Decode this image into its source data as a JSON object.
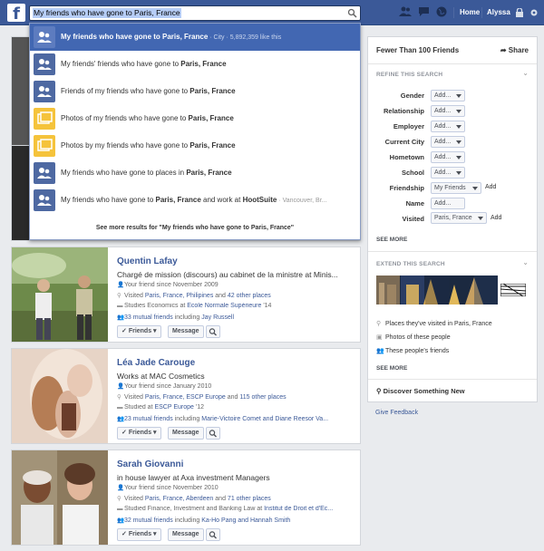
{
  "topbar": {
    "logo": "f",
    "search_value": "My friends who have gone to Paris, France",
    "home": "Home",
    "user": "Alyssa"
  },
  "typeahead": {
    "items": [
      {
        "pre": "My friends who have gone to ",
        "bold": "Paris, France",
        "post": "",
        "meta": " · City · 5,892,359 like this",
        "icon": "person-icon"
      },
      {
        "pre": "My friends' friends who have gone to ",
        "bold": "Paris, France",
        "post": "",
        "meta": "",
        "icon": "person-icon"
      },
      {
        "pre": "Friends of my friends who have gone to ",
        "bold": "Paris, France",
        "post": "",
        "meta": "",
        "icon": "person-icon"
      },
      {
        "pre": "Photos of my friends who have gone to ",
        "bold": "Paris, France",
        "post": "",
        "meta": "",
        "icon": "photo-icon"
      },
      {
        "pre": "Photos by my friends who have gone to ",
        "bold": "Paris, France",
        "post": "",
        "meta": "",
        "icon": "photo-icon"
      },
      {
        "pre": "My friends who have gone to places in ",
        "bold": "Paris, France",
        "post": "",
        "meta": "",
        "icon": "person-icon"
      },
      {
        "pre": "My friends who have gone to ",
        "bold": "Paris, France",
        "post": " and work at ",
        "bold2": "HootSuite",
        "meta": " · Vancouver, Br...",
        "icon": "person-icon"
      }
    ],
    "see_more": "See more results for \"My friends who have gone to Paris, France\""
  },
  "results": [
    {
      "name": "Quentin Lafay",
      "job": "Chargé de mission (discours) au cabinet de la ministre at Minis...",
      "since": "Your friend since November 2009",
      "visited_pre": "Visited ",
      "visited_links": "Paris, France, Philipines",
      "visited_and": " and ",
      "visited_more": "42 other places",
      "studied_pre": "Studies Economics at ",
      "studied_link": "École Normale Supérieure",
      "studied_post": " '14",
      "mutual_link": "33 mutual friends",
      "mutual_mid": " including ",
      "mutual_names": "Jay Russell",
      "friends_btn": "Friends",
      "message_btn": "Message"
    },
    {
      "name": "Léa Jade Carouge",
      "job": "Works at MAC Cosmetics",
      "since": "Your friend since January 2010",
      "visited_pre": "Visited ",
      "visited_links": "Paris, France, ESCP Europe",
      "visited_and": " and ",
      "visited_more": "115 other places",
      "studied_pre": "Studied at ",
      "studied_link": "ESCP Europe",
      "studied_post": " '12",
      "mutual_link": "23 mutual friends",
      "mutual_mid": " including ",
      "mutual_names": "Marie-Victoire Comet and Diane Reesor Va...",
      "friends_btn": "Friends",
      "message_btn": "Message"
    },
    {
      "name": "Sarah Giovanni",
      "job": "in house lawyer at Axa investment Managers",
      "since": "Your friend since November 2010",
      "visited_pre": "Visited ",
      "visited_links": "Paris, France, Aberdeen",
      "visited_and": " and ",
      "visited_more": "71 other places",
      "studied_pre": "Studied Finance, Investment and Banking Law at ",
      "studied_link": "Institut de Droit et d'Éc...",
      "studied_post": "",
      "mutual_link": "32 mutual friends",
      "mutual_mid": " including ",
      "mutual_names": "Ka-Ho Pang and Hannah Smith",
      "friends_btn": "Friends",
      "message_btn": "Message"
    }
  ],
  "right": {
    "title": "Fewer Than 100 Friends",
    "share": "Share",
    "refine": "REFINE THIS SEARCH",
    "filters": [
      {
        "label": "Gender",
        "value": "Add..."
      },
      {
        "label": "Relationship",
        "value": "Add..."
      },
      {
        "label": "Employer",
        "value": "Add..."
      },
      {
        "label": "Current City",
        "value": "Add..."
      },
      {
        "label": "Hometown",
        "value": "Add..."
      },
      {
        "label": "School",
        "value": "Add..."
      },
      {
        "label": "Friendship",
        "value": "My Friends",
        "add": "Add"
      },
      {
        "label": "Name",
        "value": "Add..."
      },
      {
        "label": "Visited",
        "value": "Paris, France",
        "add": "Add"
      }
    ],
    "see_more": "SEE MORE",
    "extend": "EXTEND THIS SEARCH",
    "extend_items": [
      "Places they've visited in Paris, France",
      "Photos of these people",
      "These people's friends"
    ],
    "see_more2": "SEE MORE",
    "discover": "Discover Something New",
    "feedback": "Give Feedback"
  },
  "colors": {
    "brand": "#3b5998",
    "selected": "#4267b2",
    "background": "#e9ebee"
  }
}
